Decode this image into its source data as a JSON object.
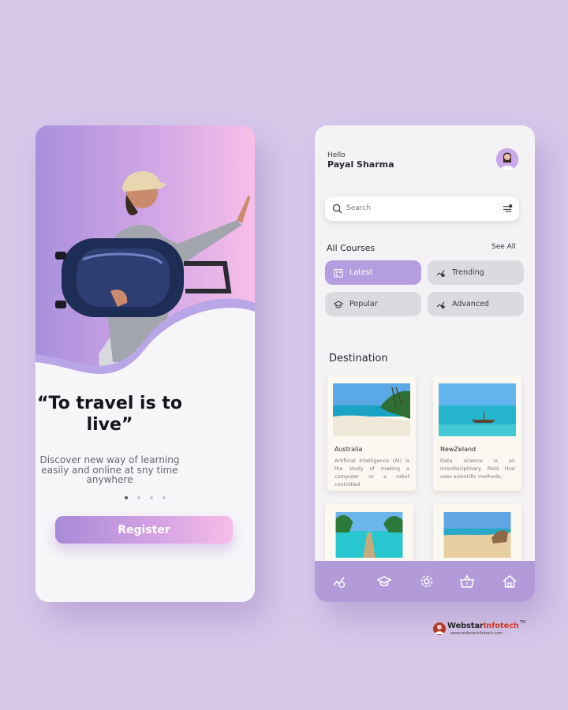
{
  "colors": {
    "background": "#d7c8ea",
    "accent": "#b49ee0",
    "nav": "#b39bd9",
    "hero_gradient_start": "#a890dc",
    "hero_gradient_end": "#f7bfe8"
  },
  "onboarding": {
    "pager": {
      "pages": 4,
      "active_index": 0
    },
    "quote": "“To travel is to live”",
    "subtext": "Discover new way of learning easily and online at sny time anywhere",
    "register_label": "Register"
  },
  "home": {
    "greeting": "Hello",
    "user_name": "Payal Sharma",
    "avatar_icon": "user-avatar",
    "search": {
      "placeholder": "Search",
      "icon": "search-icon",
      "filter_icon": "filter-icon"
    },
    "courses_title": "All Courses",
    "see_all_label": "See All",
    "chips": [
      {
        "label": "Latest",
        "icon": "calendar-icon",
        "active": true
      },
      {
        "label": "Trending",
        "icon": "trending-icon",
        "active": false
      },
      {
        "label": "Popular",
        "icon": "graduation-cap-icon",
        "active": false
      },
      {
        "label": "Advanced",
        "icon": "trending-check-icon",
        "active": false
      }
    ],
    "destination_title": "Destination",
    "destinations": [
      {
        "title": "Australia",
        "description": "Artificial Intelligence (AI) is the study of making a computer or a robot controlled"
      },
      {
        "title": "NewZeland",
        "description": "Data science is an interdisciplinary field that uses scientific methods,"
      },
      {
        "title": "",
        "description": ""
      },
      {
        "title": "",
        "description": ""
      }
    ],
    "nav_items": [
      {
        "icon": "progress-icon"
      },
      {
        "icon": "graduation-cap-icon"
      },
      {
        "icon": "settings-icon"
      },
      {
        "icon": "basket-icon"
      },
      {
        "icon": "home-icon"
      }
    ]
  },
  "brand": {
    "name_part1": "Webstar",
    "name_part2": "Infotech",
    "tm": "TM",
    "url": "www.webstarinfotech.com"
  }
}
